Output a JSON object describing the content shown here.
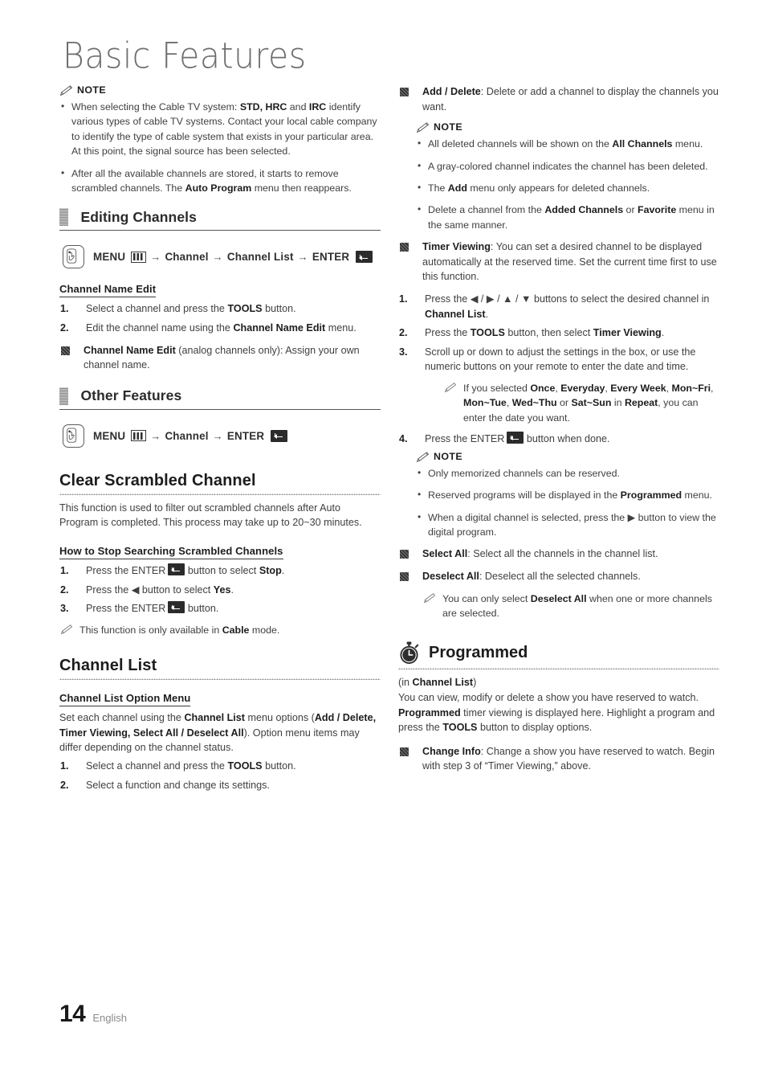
{
  "page": {
    "title": "Basic Features",
    "number": "14",
    "language": "English"
  },
  "icons": {
    "pencil": "pencil-icon",
    "hand_button": "hand-press-button-icon",
    "menu": "menu-bars-icon",
    "enter": "enter-return-icon",
    "stopwatch": "stopwatch-icon",
    "square_bullet": "filled-square-bullet-icon"
  },
  "labels": {
    "note": "NOTE",
    "arrow": "→",
    "menu_word": "MENU",
    "enter_word": "ENTER",
    "left_tri": "◀",
    "right_tri": "▶",
    "up_tri": "▲",
    "down_tri": "▼",
    "slash": "/"
  },
  "left_column": {
    "note_block": {
      "heading": "NOTE",
      "bullets": [
        "When selecting the Cable TV system: <b>STD, HRC</b> and <b>IRC</b> identify various types of cable TV systems. Contact your local cable company to identify the type of cable system that exists in your particular area. At this point, the signal source has been selected.",
        "After all the available channels are stored, it starts to remove scrambled channels. The <b>Auto Program</b> menu then reappears."
      ]
    },
    "editing_channels": {
      "heading": "Editing Channels",
      "menu_path": [
        "MENU",
        "Channel",
        "Channel List",
        "ENTER"
      ],
      "sub_heading": "Channel Name Edit",
      "steps": [
        {
          "num": "1.",
          "text": "Select a channel and press the <b>TOOLS</b> button."
        },
        {
          "num": "2.",
          "text": "Edit the channel name using the <b>Channel Name Edit</b> menu."
        }
      ],
      "square_items": [
        "<b>Channel Name Edit</b> (analog channels only): Assign your own channel name."
      ]
    },
    "other_features": {
      "heading": "Other Features",
      "menu_path": [
        "MENU",
        "Channel",
        "ENTER"
      ]
    },
    "clear_scrambled_channel": {
      "heading": "Clear Scrambled Channel",
      "intro": "This function is used to filter out scrambled channels after Auto Program is completed. This process may take up to 20~30 minutes.",
      "sub_heading": "How to Stop Searching Scrambled Channels",
      "steps": [
        {
          "num": "1.",
          "text": "Press the <e></e> button to select <b>Stop</b>."
        },
        {
          "num": "2.",
          "text": "Press the ◀ button to select <b>Yes</b>."
        },
        {
          "num": "3.",
          "text": "Press the <e></e> button."
        }
      ],
      "note": "This function is only available in <b>Cable</b> mode."
    },
    "channel_list": {
      "heading": "Channel List",
      "sub_heading": "Channel List Option Menu",
      "intro": "Set each channel using the <b>Channel List</b> menu options (<b>Add / Delete, Timer Viewing, Select All / Deselect All</b>). Option menu items may differ depending on the channel status.",
      "steps": [
        {
          "num": "1.",
          "text": "Select a channel and press the <b>TOOLS</b> button."
        },
        {
          "num": "2.",
          "text": "Select a function and change its settings."
        }
      ]
    }
  },
  "right_column": {
    "add_delete": {
      "text": "<b>Add / Delete</b>: Delete or add a channel to display the channels you want.",
      "note_heading": "NOTE",
      "note_bullets": [
        "All deleted channels will be shown on the <b>All Channels</b> menu.",
        "A gray-colored channel indicates the channel has been deleted.",
        "The <b>Add</b> menu only appears for deleted channels.",
        "Delete a channel from the <b>Added Channels</b> or <b>Favorite</b> menu in the same manner."
      ]
    },
    "timer_viewing": {
      "text": "<b>Timer Viewing</b>: You can set a desired channel to be displayed automatically at the reserved time. Set the current time first to use this function.",
      "steps": [
        {
          "num": "1.",
          "text": "Press the ◀ / ▶ / ▲ / ▼ buttons to select the desired channel in <b>Channel List</b>."
        },
        {
          "num": "2.",
          "text": "Press the <b>TOOLS</b> button, then select <b>Timer Viewing</b>."
        },
        {
          "num": "3.",
          "text": "Scroll up or down to adjust the settings in the box, or use the numeric buttons on your remote to enter the date and time."
        },
        {
          "num": "4.",
          "text": "Press the <e></e> button when done."
        }
      ],
      "step3_note": "If you selected <b>Once</b>, <b>Everyday</b>, <b>Every Week</b>, <b>Mon~Fri</b>, <b>Mon~Tue</b>, <b>Wed~Thu</b> or <b>Sat~Sun</b> in <b>Repeat</b>, you can enter the date you want.",
      "note_heading": "NOTE",
      "note_bullets": [
        "Only memorized channels can be reserved.",
        "Reserved programs will be displayed in the <b>Programmed</b> menu.",
        "When a digital channel is selected, press the ▶ button to view the digital program."
      ]
    },
    "select_all": "<b>Select All</b>: Select all the channels in the channel list.",
    "deselect_all": "<b>Deselect All</b>: Deselect all the selected channels.",
    "deselect_all_note": "You can only select <b>Deselect All</b> when one or more channels are selected.",
    "programmed": {
      "heading": "Programmed",
      "context": "(in <b>Channel List</b>)",
      "intro": "You can view, modify or delete a show you have reserved to watch. <b>Programmed</b> timer viewing is displayed here. Highlight a program and press the <b>TOOLS</b> button to display options.",
      "square_items": [
        "<b>Change Info</b>: Change a show you have reserved to watch. Begin with step 3 of &ldquo;Timer Viewing,&rdquo; above."
      ]
    }
  }
}
